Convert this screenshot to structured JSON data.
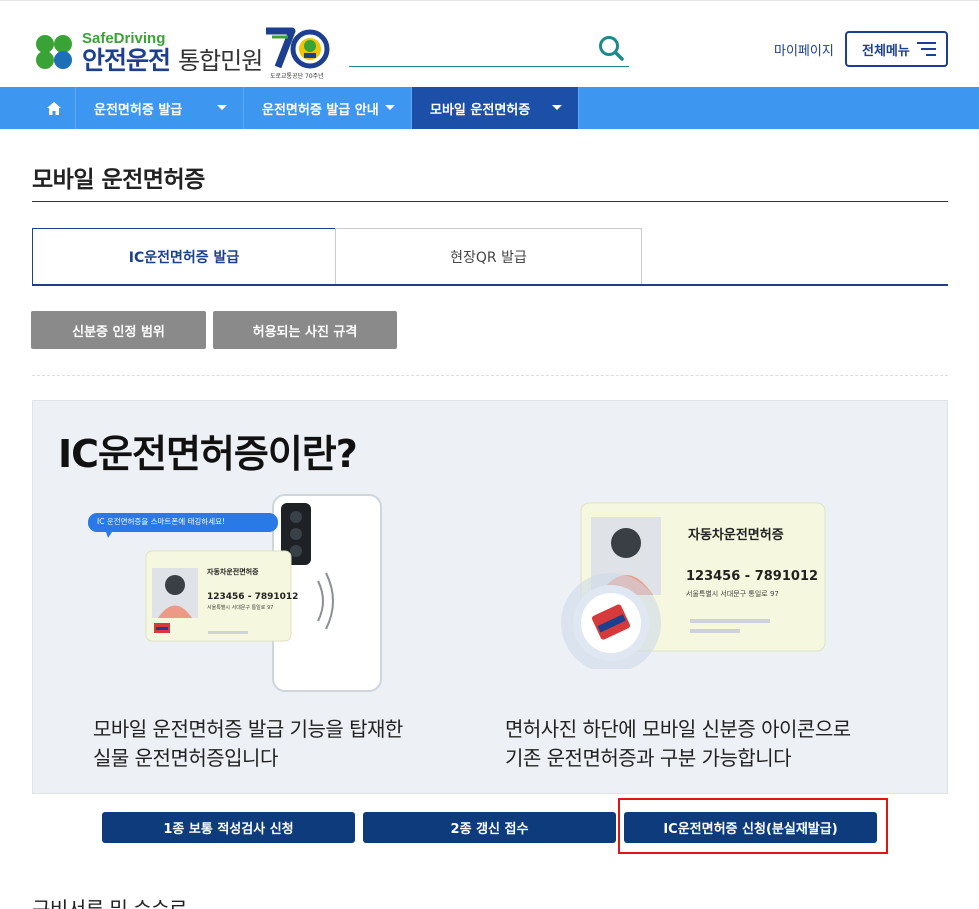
{
  "header": {
    "logo_en": "SafeDriving",
    "logo_ko_main": "안전운전",
    "logo_ko_sub": "통합민원",
    "badge_caption": "도로교통공단 70주년",
    "search_placeholder": "",
    "mypage_label": "마이페이지",
    "allmenu_label": "전체메뉴"
  },
  "nav": {
    "items": [
      {
        "label": "운전면허증 발급"
      },
      {
        "label": "운전면허증 발급 안내"
      },
      {
        "label": "모바일 운전면허증"
      }
    ]
  },
  "page": {
    "title": "모바일 운전면허증"
  },
  "tabs": [
    {
      "label": "IC운전면허증 발급",
      "active": true
    },
    {
      "label": "현장QR 발급",
      "active": false
    }
  ],
  "sub_buttons": [
    {
      "label": "신분증 인정 범위"
    },
    {
      "label": "허용되는 사진 규격"
    }
  ],
  "info": {
    "title": "IC운전면허증이란?",
    "bubble": "IC 운전면허증을 스마트폰에 태깅하세요!",
    "card_small": {
      "title": "자동차운전면허증",
      "number": "123456 - 7891012",
      "address": "서울특별시 서대문구 통일로 97"
    },
    "card_large": {
      "title": "자동차운전면허증",
      "number": "123456 - 7891012",
      "address": "서울특별시 서대문구 통일로 97"
    },
    "caption_left": [
      "모바일 운전면허증 발급 기능을 탑재한",
      "실물 운전면허증입니다"
    ],
    "caption_right": [
      "면허사진 하단에 모바일 신분증 아이콘으로",
      "기존 운전면허증과 구분 가능합니다"
    ]
  },
  "actions": [
    {
      "label": "1종 보통 적성검사 신청"
    },
    {
      "label": "2종 갱신 접수"
    },
    {
      "label": "IC운전면허증 신청(분실재발급)"
    }
  ],
  "bottom_cut_text": "구비서류 및 수수료",
  "colors": {
    "brand_navy": "#1d3f8f",
    "nav_blue": "#3d97f0",
    "nav_active": "#1c4fa8",
    "button_navy": "#0e3b7c",
    "highlight_red": "#e01515",
    "logo_green": "#3aa335"
  }
}
